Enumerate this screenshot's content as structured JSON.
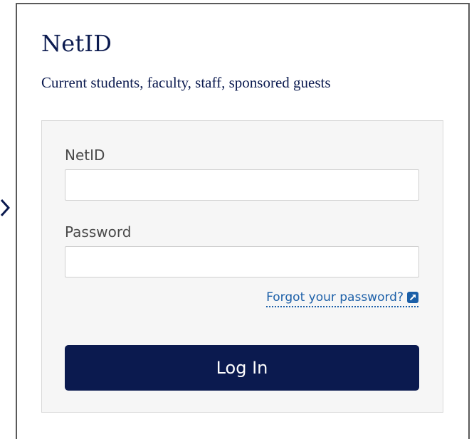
{
  "header": {
    "title": "NetID",
    "subtitle": "Current students, faculty, staff, sponsored guests"
  },
  "form": {
    "netid_label": "NetID",
    "netid_value": "",
    "password_label": "Password",
    "password_value": "",
    "forgot_link": "Forgot your password?",
    "login_button": "Log In"
  },
  "icons": {
    "chevron": "chevron-right-icon",
    "external": "external-link-icon"
  },
  "colors": {
    "brand_navy": "#0b1a4f",
    "link_blue": "#1b5fa8",
    "form_background": "#f6f6f6"
  }
}
